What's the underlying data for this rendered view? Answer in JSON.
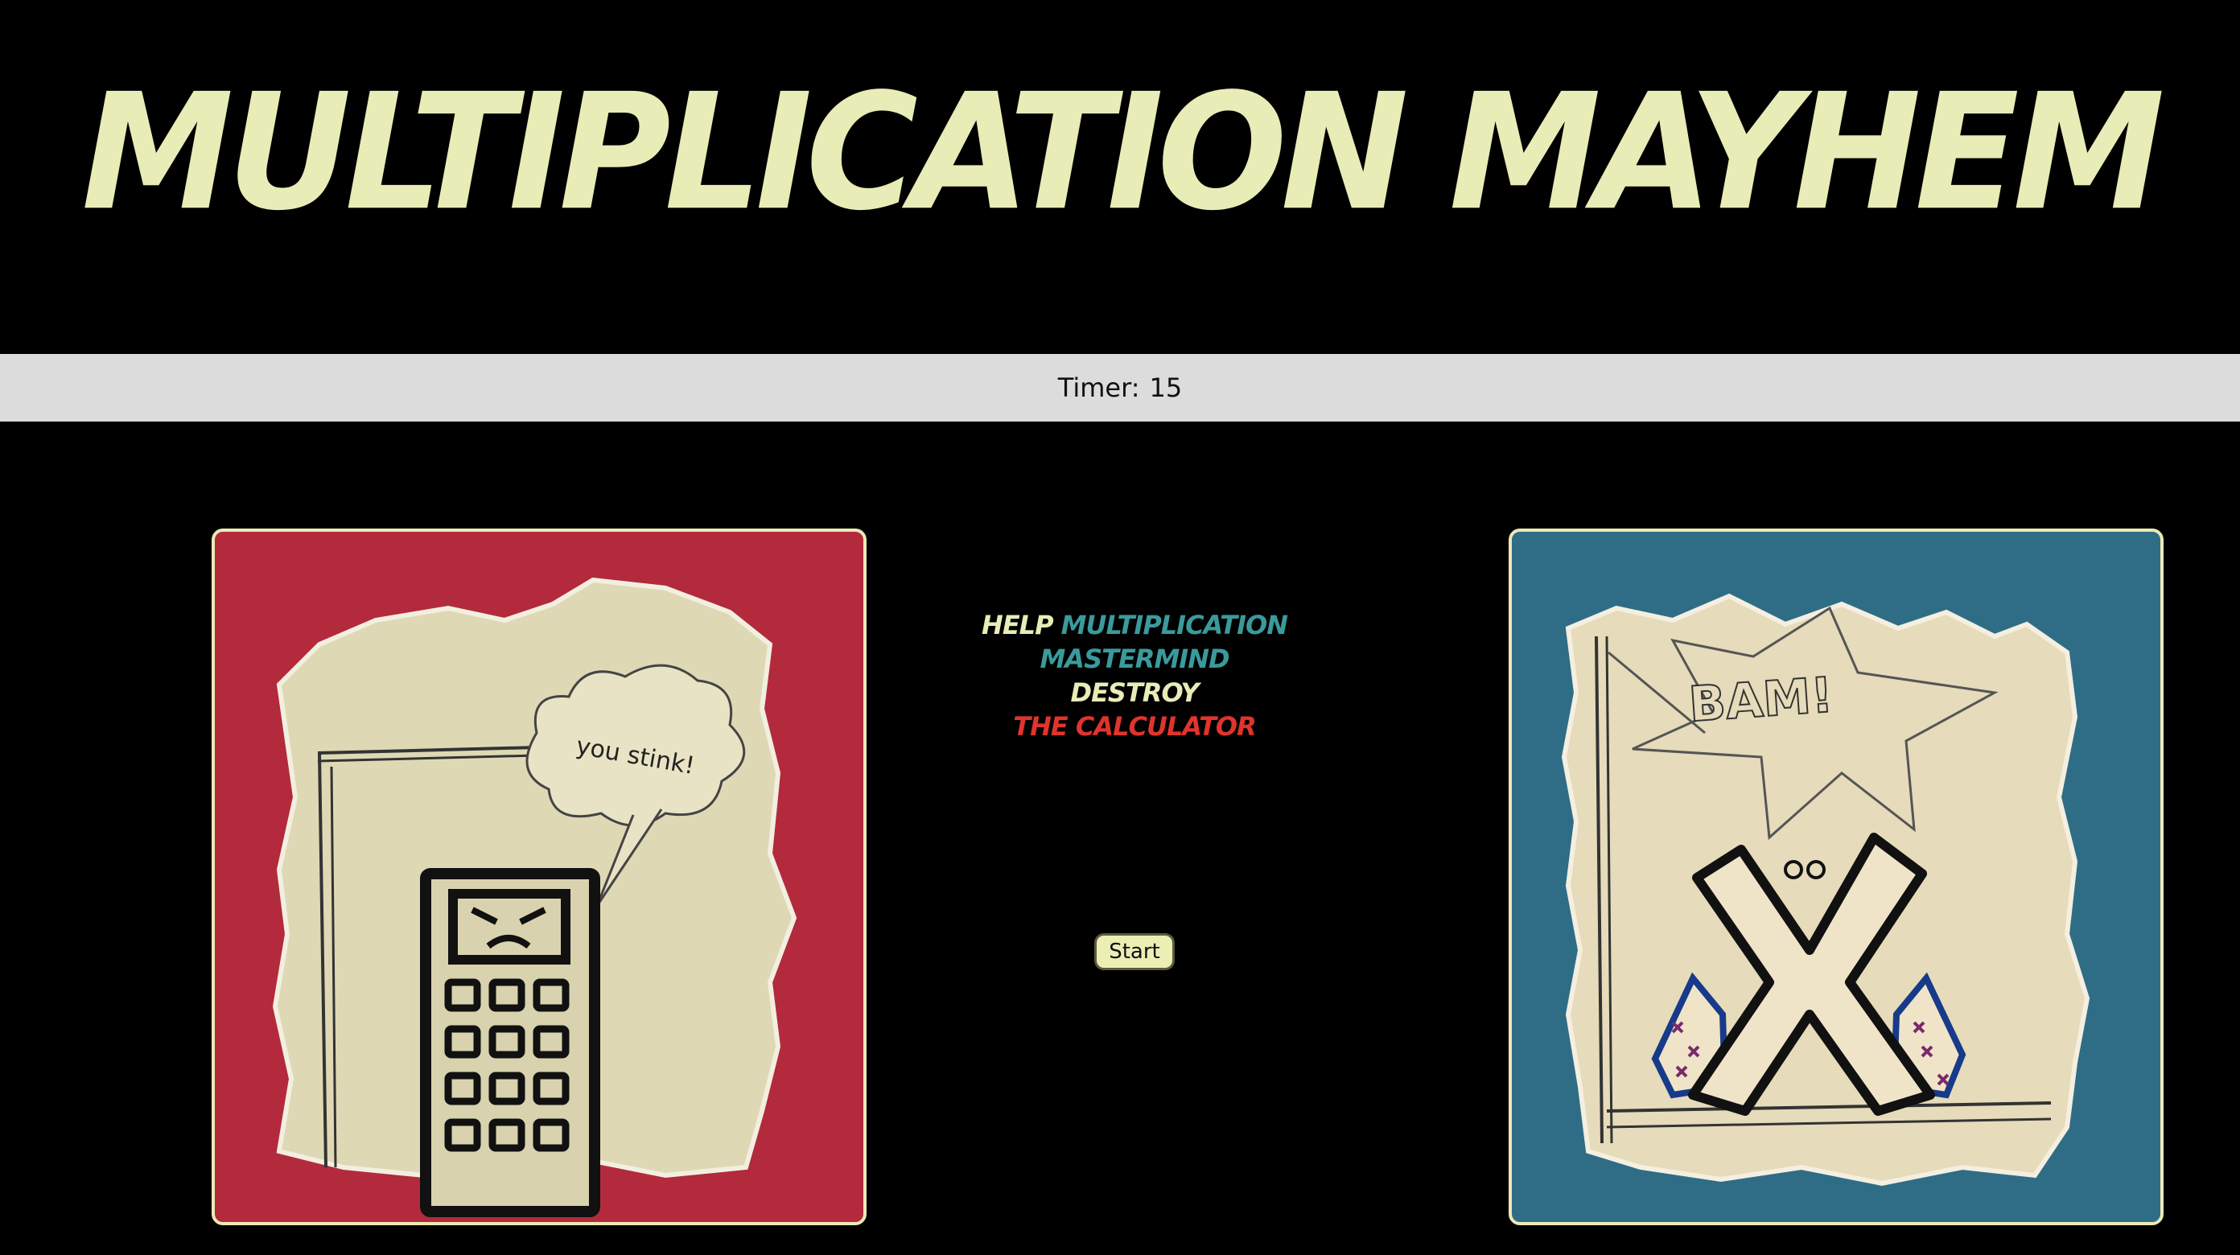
{
  "title": "Multiplication Mayhem",
  "timer": {
    "label": "Timer:",
    "value": "15"
  },
  "intro": {
    "help": "Help",
    "hero": "Multiplication Mastermind",
    "destroy": "Destroy",
    "villain": "The Calculator"
  },
  "start_button": "Start",
  "left_panel": {
    "speech_text": "you stink!"
  },
  "right_panel": {
    "burst_text": "BAM!"
  },
  "colors": {
    "background": "#000000",
    "title": "#e8ecb6",
    "timer_bar": "#dcdcdc",
    "hero_teal": "#3a9a9c",
    "villain_red": "#e0342c",
    "left_panel_bg": "#b22a3c",
    "right_panel_bg": "#2f6d86",
    "panel_border": "#ece9b6"
  }
}
